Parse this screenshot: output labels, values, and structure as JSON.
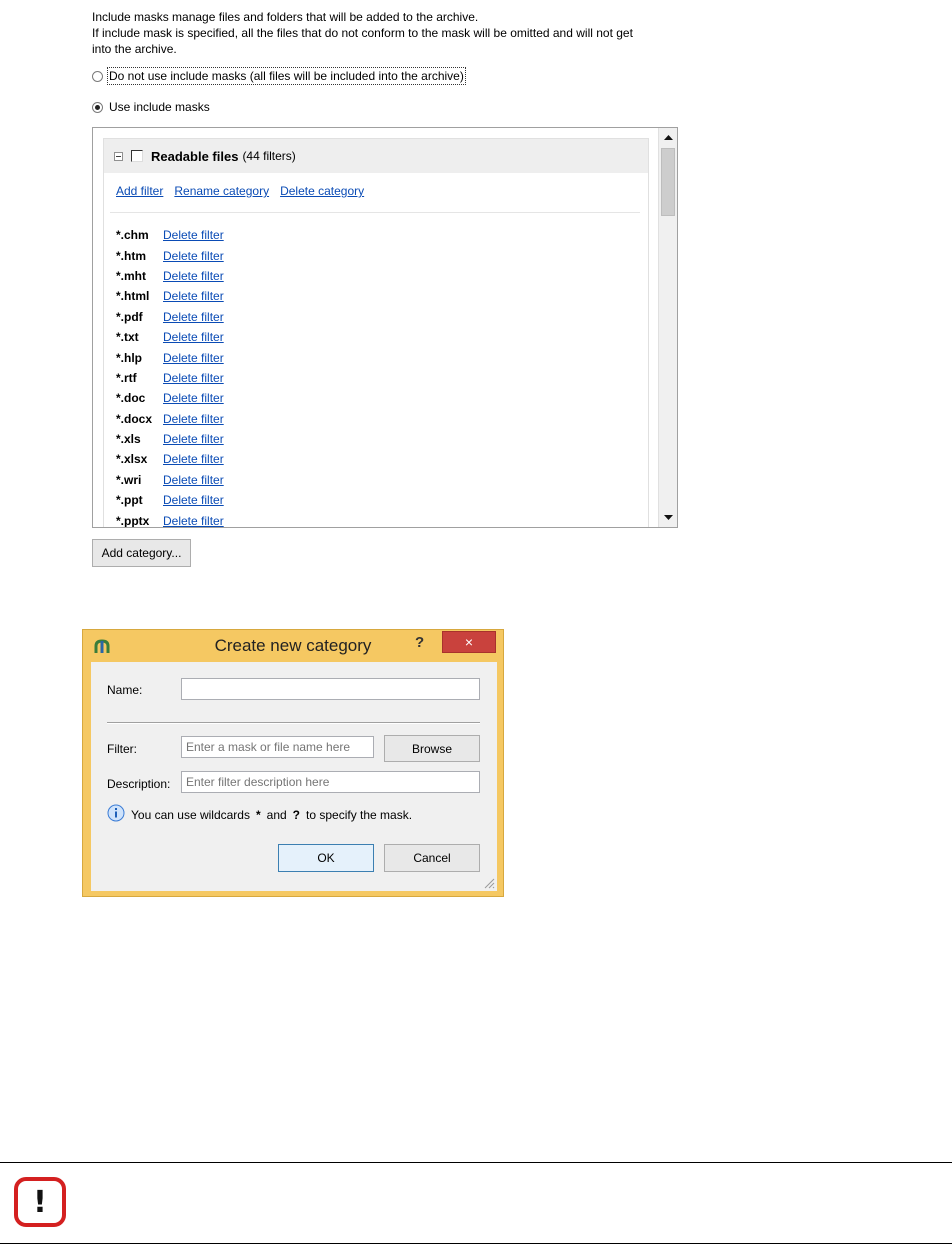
{
  "intro": {
    "line1": "Include masks manage files and folders that will be added to the archive.",
    "line2": "If include mask is specified, all the files that do not conform to the mask will be omitted and will not get",
    "line3": "into the archive."
  },
  "options": {
    "no_masks_label": "Do not use include masks (all files will be included into the archive)",
    "no_masks_selected": false,
    "use_masks_label": "Use include masks",
    "use_masks_selected": true
  },
  "category": {
    "title": "Readable files",
    "count": "(44 filters)",
    "checked": false,
    "add_filter": "Add filter",
    "rename_category": "Rename category",
    "delete_category": "Delete category",
    "filters": [
      "*.chm",
      "*.htm",
      "*.mht",
      "*.html",
      "*.pdf",
      "*.txt",
      "*.hlp",
      "*.rtf",
      "*.doc",
      "*.docx",
      "*.xls",
      "*.xlsx",
      "*.wri",
      "*.ppt",
      "*.pptx"
    ],
    "delete_filter_label": "Delete filter"
  },
  "add_category_button": "Add category...",
  "dialog": {
    "title": "Create new category",
    "help": "?",
    "close": "×",
    "name_label": "Name:",
    "name_value": "",
    "filter_label": "Filter:",
    "filter_placeholder": "Enter a mask or file name here",
    "browse": "Browse",
    "description_label": "Description:",
    "description_placeholder": "Enter filter description here",
    "hint_pre": "You can use wildcards",
    "hint_star": "*",
    "hint_and": "and",
    "hint_q": "?",
    "hint_post": "to specify the mask.",
    "ok": "OK",
    "cancel": "Cancel"
  },
  "warning_icon": "exclamation-warning-icon",
  "colors": {
    "link": "#0a4bb5",
    "dialog_frame": "#f5c862",
    "close_button": "#c9423d",
    "warning_border": "#d42020"
  }
}
